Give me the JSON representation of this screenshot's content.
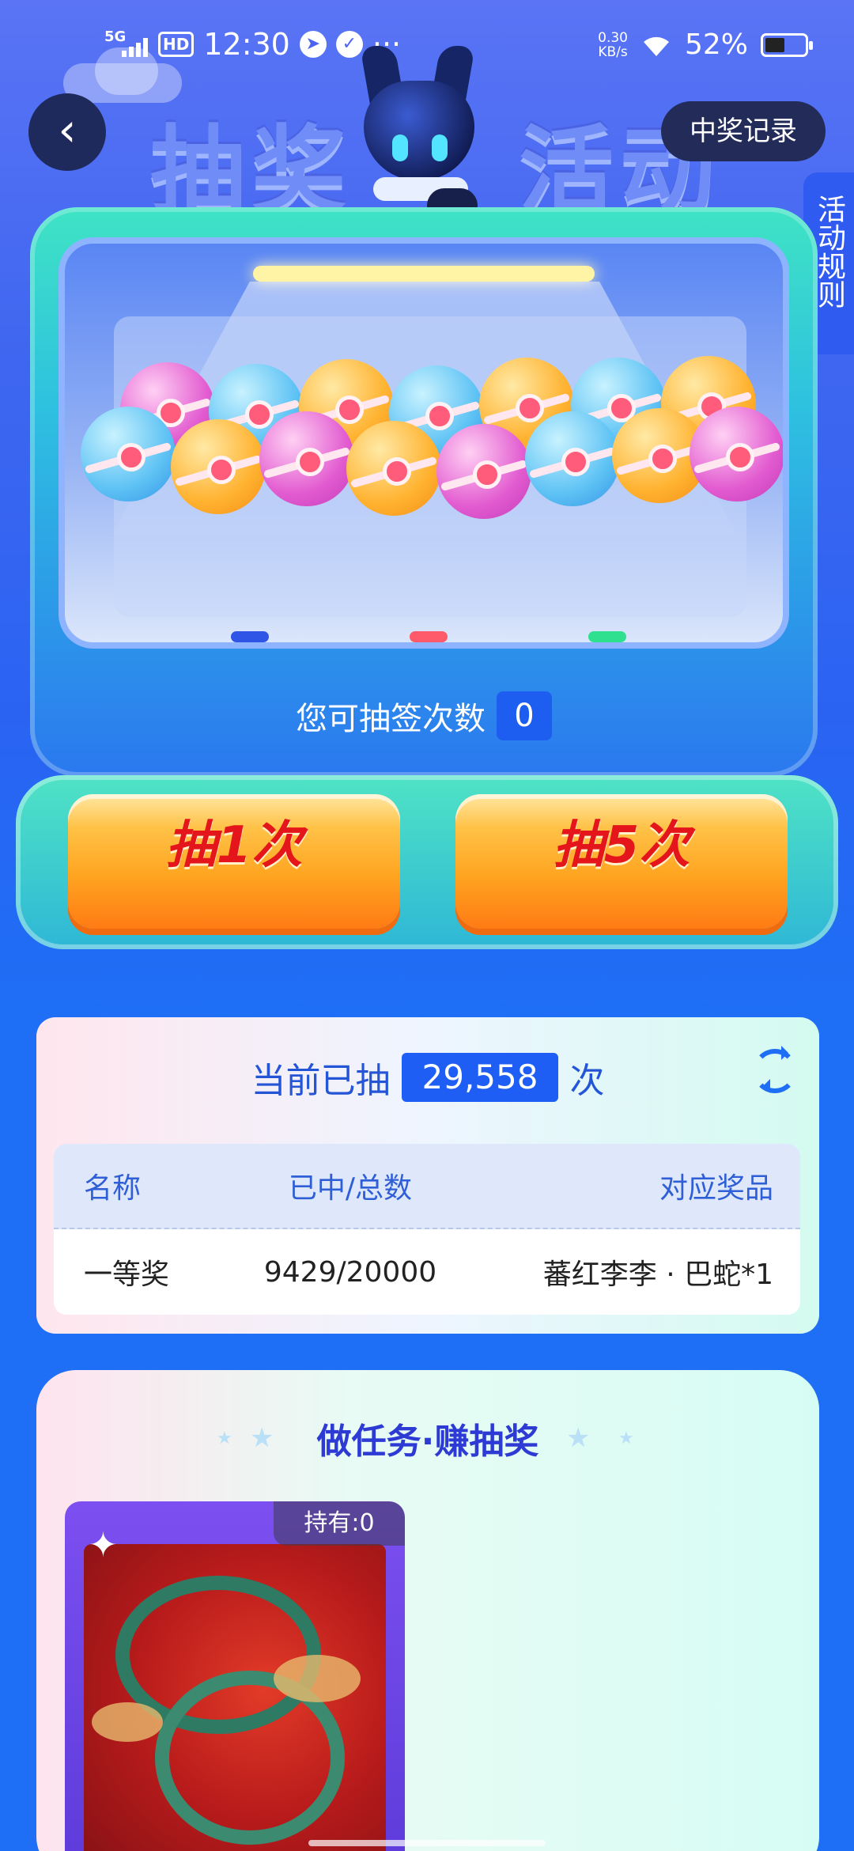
{
  "status_bar": {
    "network": "5G",
    "hd": "HD",
    "time": "12:30",
    "more": "···",
    "speed_value": "0.30",
    "speed_unit": "KB/s",
    "battery": "52%"
  },
  "header": {
    "title_left": "抽奖",
    "title_right": "活动",
    "back_icon": "chevron-left-icon",
    "record_button": "中奖记录",
    "rules_tab": "活动规则"
  },
  "machine": {
    "draw_count_label": "您可抽签次数",
    "draw_count_value": "0",
    "balls": [
      "pink",
      "blue",
      "orange",
      "blue",
      "orange",
      "blue",
      "orange",
      "blue",
      "orange",
      "pink",
      "orange",
      "pink",
      "blue",
      "orange",
      "pink"
    ],
    "buttons": {
      "draw_once": "抽1次",
      "draw_five": "抽5次"
    }
  },
  "stats": {
    "prefix": "当前已抽",
    "value": "29,558",
    "suffix": "次",
    "refresh_icon": "refresh-icon",
    "table": {
      "headers": [
        "名称",
        "已中/总数",
        "对应奖品"
      ],
      "rows": [
        {
          "name": "一等奖",
          "ratio": "9429/20000",
          "prize": "蕃红李李 · 巴蛇*1"
        }
      ]
    }
  },
  "tasks": {
    "title": "做任务·赚抽奖",
    "item": {
      "holding": "持有:0"
    }
  },
  "colors": {
    "accent": "#1e6ff5",
    "button_text": "#e4151b",
    "title": "#2d3bd4"
  }
}
